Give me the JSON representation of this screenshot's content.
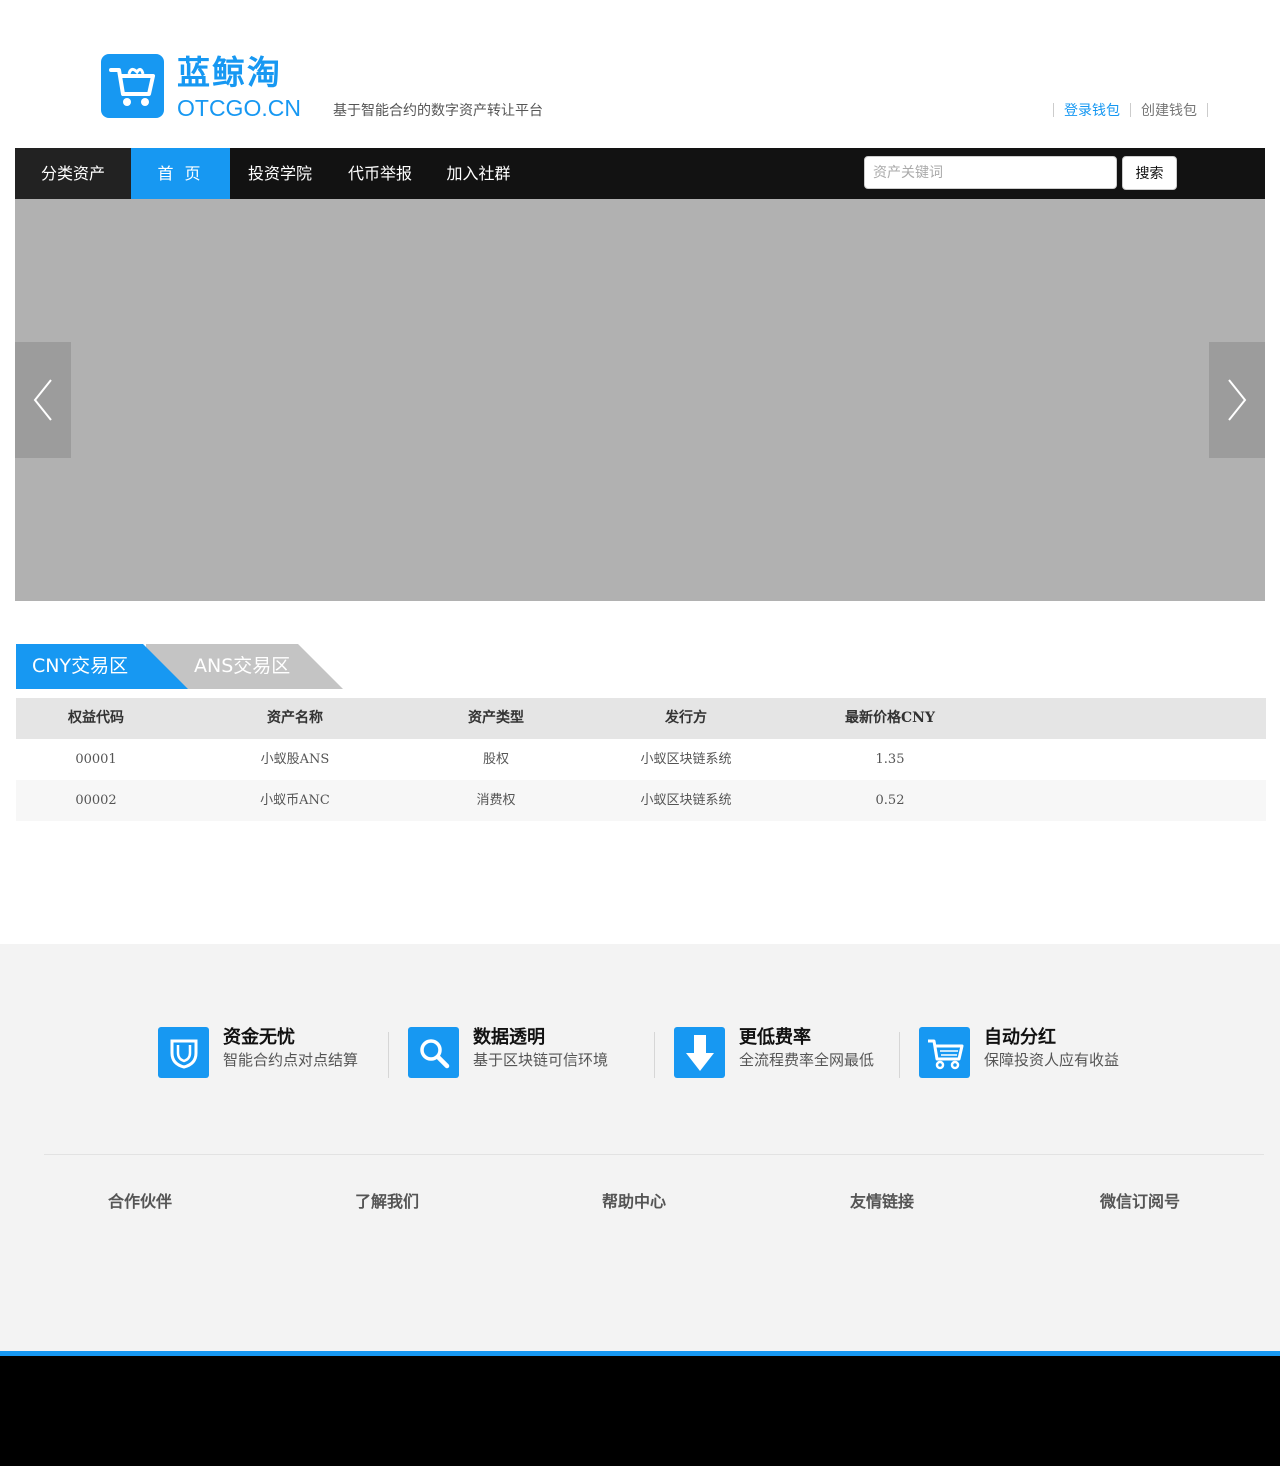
{
  "brand": {
    "name_cn": "蓝鲸淘",
    "name_en": "OTCGO.CN",
    "slogan": "基于智能合约的数字资产转让平台",
    "color": "#1798f2"
  },
  "user_links": {
    "login": "登录钱包",
    "create": "创建钱包"
  },
  "nav": {
    "category": "分类资产",
    "items": [
      "首 页",
      "投资学院",
      "代币举报",
      "加入社群"
    ],
    "search_placeholder": "资产关键词",
    "search_button": "搜索"
  },
  "banner": {
    "prev_icon": "chevron-left-icon",
    "next_icon": "chevron-right-icon"
  },
  "tabs": [
    {
      "label": "CNY交易区",
      "active": true
    },
    {
      "label": "ANS交易区",
      "active": false
    }
  ],
  "table": {
    "headers": [
      "权益代码",
      "资产名称",
      "资产类型",
      "发行方",
      "最新价格CNY"
    ],
    "rows": [
      [
        "00001",
        "小蚁股ANS",
        "股权",
        "小蚁区块链系统",
        "1.35"
      ],
      [
        "00002",
        "小蚁币ANC",
        "消费权",
        "小蚁区块链系统",
        "0.52"
      ]
    ]
  },
  "features": [
    {
      "title": "资金无忧",
      "desc": "智能合约点对点结算",
      "icon": "shield-icon"
    },
    {
      "title": "数据透明",
      "desc": "基于区块链可信环境",
      "icon": "magnifier-icon"
    },
    {
      "title": "更低费率",
      "desc": "全流程费率全网最低",
      "icon": "arrow-down-icon"
    },
    {
      "title": "自动分红",
      "desc": "保障投资人应有收益",
      "icon": "cart-icon"
    }
  ],
  "footer_links": [
    "合作伙伴",
    "了解我们",
    "帮助中心",
    "友情链接",
    "微信订阅号"
  ]
}
